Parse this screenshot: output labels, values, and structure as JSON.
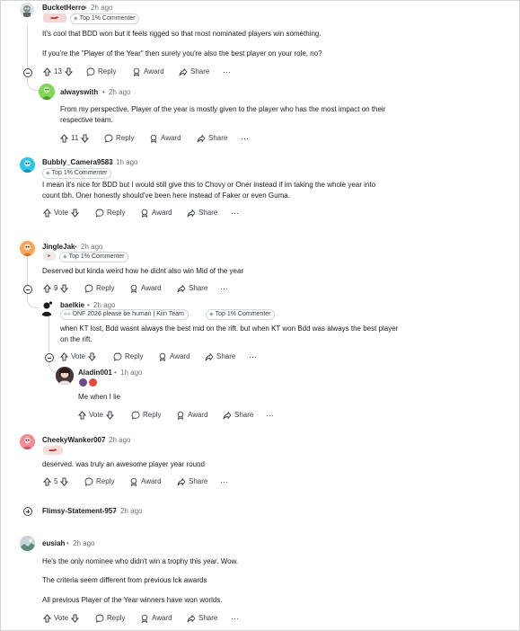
{
  "comments": {
    "c1": {
      "username": "BucketHerro",
      "time": "2h ago",
      "flair": "Top 1% Commenter",
      "lines": [
        "It's cool that BDD won but it feels rigged so that most nominated players win something.",
        "If you're the \"Player of the Year\" then surely you're also the best player on your role, no?"
      ],
      "votes": "13",
      "reply": "Reply",
      "award": "Award",
      "share": "Share"
    },
    "c1r1": {
      "username": "alwayswith",
      "time": "2h ago",
      "lines": [
        "From my perspective, Player of the year is mostly given to the player who has the most impact on their",
        "respective team."
      ],
      "votes": "11",
      "reply": "Reply",
      "award": "Award",
      "share": "Share"
    },
    "c2": {
      "username": "Bubbly_Camera9583",
      "time": "1h ago",
      "flair": "Top 1% Commenter",
      "lines": [
        "I mean it's nice for BDD but I would still give this to Chovy or Oner instead if im taking the whole year into",
        "count tbh. Oner honestly should've been here instead of Faker or even Guma."
      ],
      "votes": "Vote",
      "reply": "Reply",
      "award": "Award",
      "share": "Share"
    },
    "c3": {
      "username": "JingleJak",
      "time": "2h ago",
      "flair": "Top 1% Commenter",
      "lines": [
        "Deserved but kinda weird how he didnt also win Mid of the year"
      ],
      "votes": "9",
      "reply": "Reply",
      "award": "Award",
      "share": "Share"
    },
    "c3r1": {
      "username": "baelkie",
      "time": "2h ago",
      "flair_team": "DNF 2026 please be human | Kiin Team",
      "flair": "Top 1% Commenter",
      "lines": [
        "when KT lost, Bdd wasnt always the best mid on the rift. but when KT won Bdd was always the best player",
        "on the rift."
      ],
      "votes": "Vote",
      "reply": "Reply",
      "award": "Award",
      "share": "Share"
    },
    "c3r2": {
      "username": "Aladin001",
      "time": "1h ago",
      "lines": [
        "Me when I lie"
      ],
      "votes": "Vote",
      "reply": "Reply",
      "award": "Award",
      "share": "Share"
    },
    "c4": {
      "username": "CheekyWanker007",
      "time": "2h ago",
      "lines": [
        "deserved. was truly an awesome player year round"
      ],
      "votes": "5",
      "reply": "Reply",
      "award": "Award",
      "share": "Share"
    },
    "c5": {
      "username": "Flimsy-Statement-957",
      "time": "2h ago"
    },
    "c6": {
      "username": "eusiah",
      "time": "2h ago",
      "lines": [
        "He's the only nominee who didn't win a trophy this year. Wow.",
        "The criteria seem different from previous lck awards",
        "All previous Player of the Year winners have won worlds."
      ],
      "votes": "Vote",
      "reply": "Reply",
      "award": "Award",
      "share": "Share"
    }
  },
  "separator": "•",
  "more": "···",
  "colors": {
    "text": "#1c1c1c",
    "meta": "#6f7479",
    "thread_line": "#d6d6d6",
    "flair_border": "#cfd5db"
  }
}
